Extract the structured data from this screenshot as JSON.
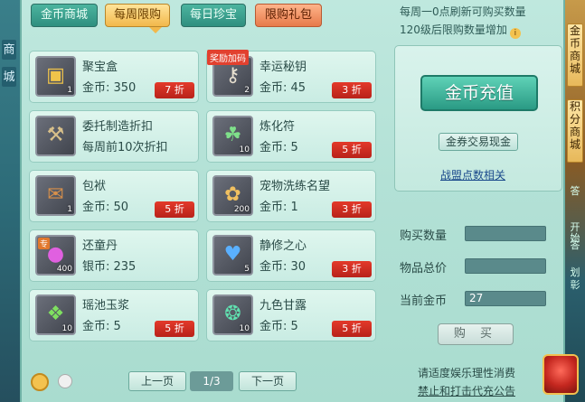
{
  "tabs": [
    {
      "label": "金币商城",
      "active": false
    },
    {
      "label": "每周限购",
      "active": true
    },
    {
      "label": "每日珍宝",
      "active": false
    },
    {
      "label": "限购礼包",
      "active": false
    }
  ],
  "notice": {
    "line1": "每周一0点刷新可购买数量",
    "line2": "120级后限购数量增加",
    "info_icon": "i"
  },
  "left_edge_chars": [
    "商",
    "城"
  ],
  "items": [
    {
      "name": "聚宝盒",
      "price": "金币: 350",
      "discount": "7 折",
      "qty": "1",
      "icon": "treasure-box-icon",
      "glyph": "▣",
      "bonus": "",
      "tag": ""
    },
    {
      "name": "幸运秘钥",
      "price": "金币: 45",
      "discount": "3 折",
      "qty": "2",
      "icon": "key-icon",
      "glyph": "⚷",
      "bonus": "奖励加码",
      "tag": ""
    },
    {
      "name": "委托制造折扣",
      "price": "每周前10次折扣",
      "discount": "",
      "qty": "",
      "icon": "hammer-icon",
      "glyph": "⚒",
      "bonus": "",
      "tag": ""
    },
    {
      "name": "炼化符",
      "price": "金币: 5",
      "discount": "5 折",
      "qty": "10",
      "icon": "talisman-icon",
      "glyph": "☘",
      "bonus": "",
      "tag": ""
    },
    {
      "name": "包袱",
      "price": "金币: 50",
      "discount": "5 折",
      "qty": "1",
      "icon": "bag-icon",
      "glyph": "✉",
      "bonus": "",
      "tag": ""
    },
    {
      "name": "宠物洗练名望",
      "price": "金币: 1",
      "discount": "3 折",
      "qty": "200",
      "icon": "paw-icon",
      "glyph": "✿",
      "bonus": "",
      "tag": ""
    },
    {
      "name": "还童丹",
      "price": "银币: 235",
      "discount": "",
      "qty": "400",
      "icon": "pill-icon",
      "glyph": "●",
      "bonus": "",
      "tag": "专"
    },
    {
      "name": "静修之心",
      "price": "金币: 30",
      "discount": "3 折",
      "qty": "5",
      "icon": "heart-icon",
      "glyph": "♥",
      "bonus": "",
      "tag": ""
    },
    {
      "name": "瑶池玉浆",
      "price": "金币: 5",
      "discount": "5 折",
      "qty": "10",
      "icon": "jade-potion-icon",
      "glyph": "❖",
      "bonus": "",
      "tag": ""
    },
    {
      "name": "九色甘露",
      "price": "金币: 5",
      "discount": "5 折",
      "qty": "10",
      "icon": "dew-potion-icon",
      "glyph": "❂",
      "bonus": "",
      "tag": ""
    }
  ],
  "right_box": {
    "recharge_label": "金币充值",
    "exchange_label": "金券交易现金",
    "points_link": "战盟点数相关"
  },
  "form": {
    "qty_label": "购买数量",
    "qty_value": "",
    "total_label": "物品总价",
    "total_value": "",
    "current_label": "当前金币",
    "current_value": "27",
    "buy_label": "购 买"
  },
  "pagination": {
    "prev": "上一页",
    "current": "1/3",
    "next": "下一页"
  },
  "footer": {
    "line1": "请适度娱乐理性消费",
    "line2": "禁止和打击代充公告"
  },
  "right_sidebar": {
    "tab1": "金币商城",
    "tab2": "积分商城",
    "cut1": "答",
    "cut2": "开始",
    "cut3": "答",
    "cut4": "划",
    "cut5": "彰"
  },
  "colors": {
    "accent": "#2a9a84",
    "discount": "#c4271f",
    "active_tab": "#f2b84b"
  }
}
